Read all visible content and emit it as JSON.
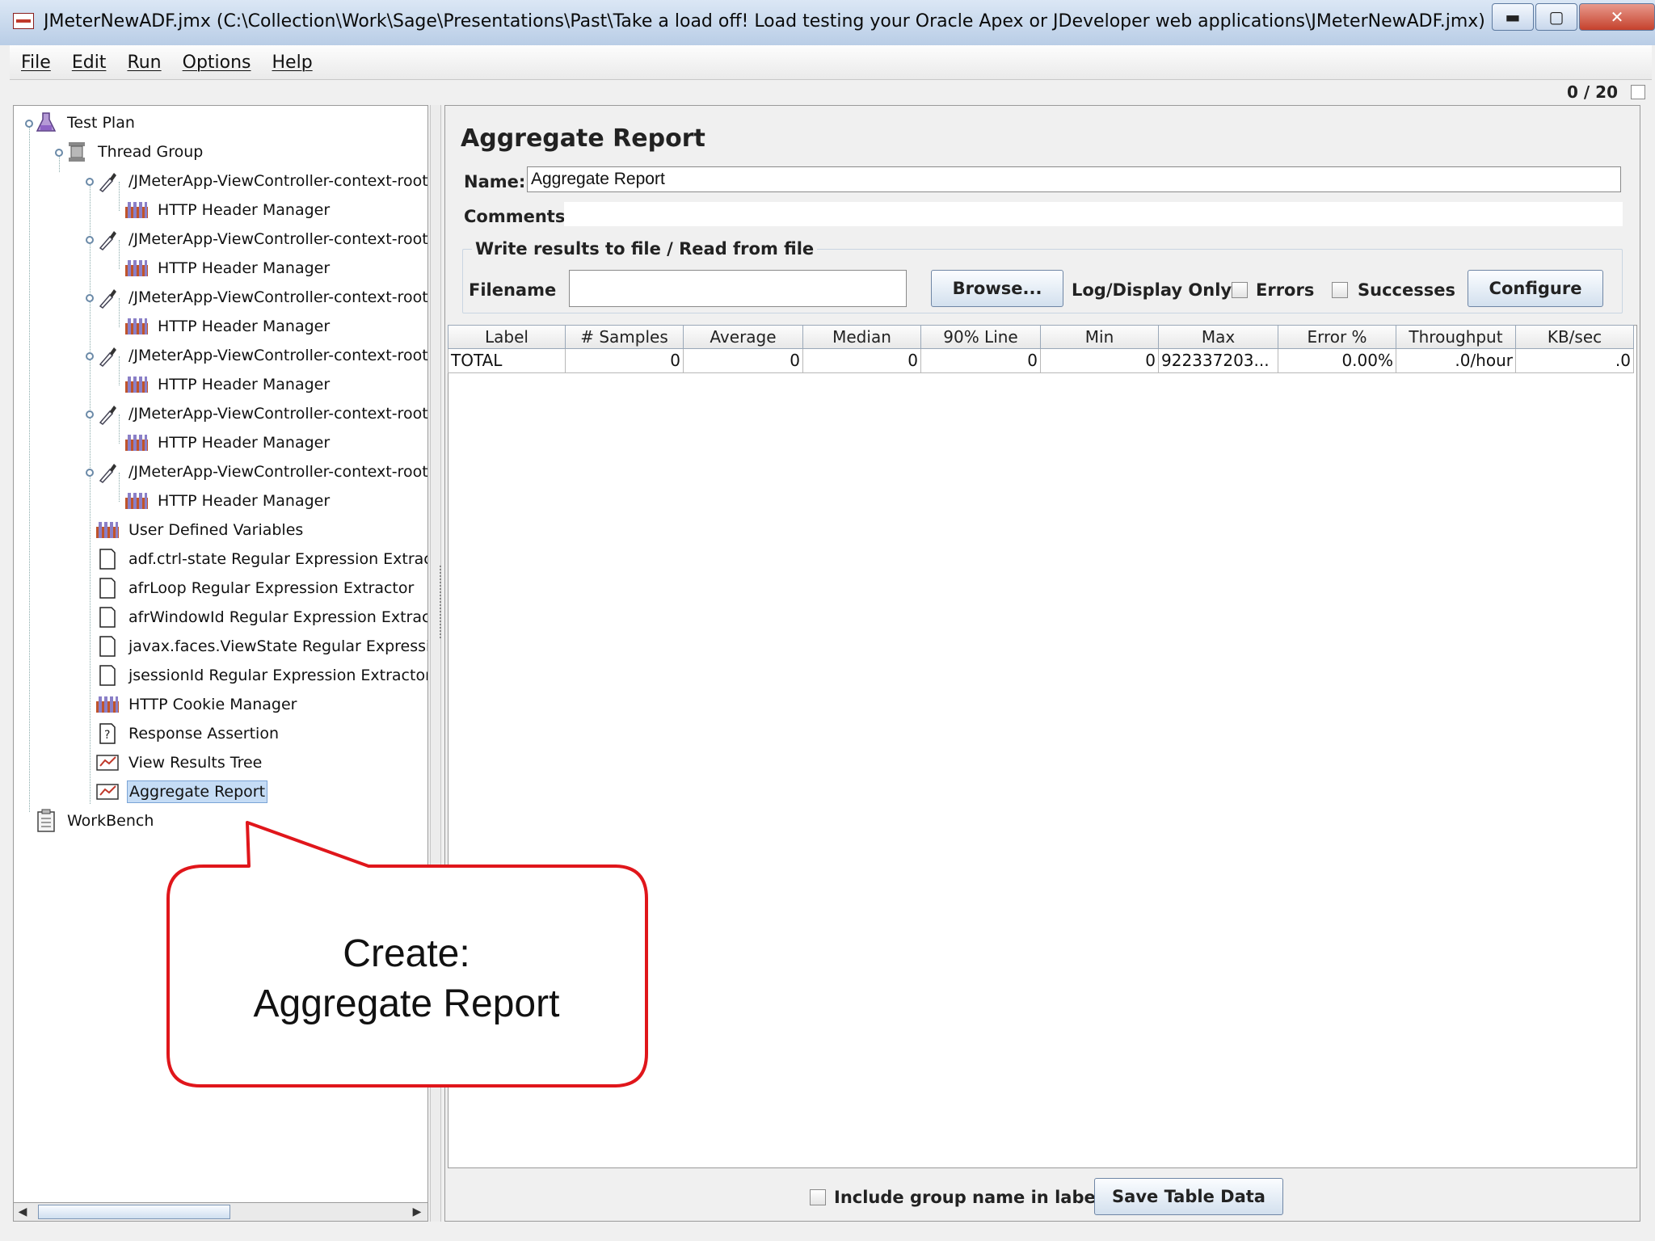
{
  "window": {
    "title": "JMeterNewADF.jmx (C:\\Collection\\Work\\Sage\\Presentations\\Past\\Take a load off!  Load testing your Oracle Apex or JDeveloper web applications\\JMeterNewADF.jmx) - Apache J...",
    "minimize": "▬",
    "maximize": "▢",
    "close": "✕"
  },
  "menu": [
    "File",
    "Edit",
    "Run",
    "Options",
    "Help"
  ],
  "status": {
    "counter": "0 / 20"
  },
  "tree": {
    "items": [
      "Test Plan",
      "Thread Group",
      "/JMeterApp-ViewController-context-root",
      "HTTP Header Manager",
      "/JMeterApp-ViewController-context-root",
      "HTTP Header Manager",
      "/JMeterApp-ViewController-context-root",
      "HTTP Header Manager",
      "/JMeterApp-ViewController-context-root",
      "HTTP Header Manager",
      "/JMeterApp-ViewController-context-root",
      "HTTP Header Manager",
      "/JMeterApp-ViewController-context-root",
      "HTTP Header Manager",
      "User Defined Variables",
      "adf.ctrl-state Regular Expression Extractor",
      "afrLoop Regular Expression Extractor",
      "afrWindowId Regular Expression Extractor",
      "javax.faces.ViewState Regular Expression Extractor",
      "jsessionId Regular Expression Extractor",
      "HTTP Cookie Manager",
      "Response Assertion",
      "View Results Tree",
      "Aggregate Report",
      "WorkBench"
    ]
  },
  "panel": {
    "title": "Aggregate Report",
    "name_label": "Name:",
    "name_value": "Aggregate Report",
    "comments_label": "Comments:",
    "file_group_legend": "Write results to file / Read from file",
    "filename_label": "Filename",
    "filename_value": "",
    "browse_button": "Browse...",
    "log_display_label": "Log/Display Only:",
    "errors_label": "Errors",
    "successes_label": "Successes",
    "configure_button": "Configure"
  },
  "table": {
    "columns": [
      "Label",
      "# Samples",
      "Average",
      "Median",
      "90% Line",
      "Min",
      "Max",
      "Error %",
      "Throughput",
      "KB/sec"
    ],
    "rows": [
      [
        "TOTAL",
        "0",
        "0",
        "0",
        "0",
        "0",
        "922337203...",
        "0.00%",
        ".0/hour",
        ".0"
      ]
    ]
  },
  "footer": {
    "include_group_label": "Include group name in label?",
    "save_button": "Save Table Data"
  },
  "callout": {
    "line1": "Create:",
    "line2": "Aggregate Report",
    "border_color": "#e0161b"
  }
}
